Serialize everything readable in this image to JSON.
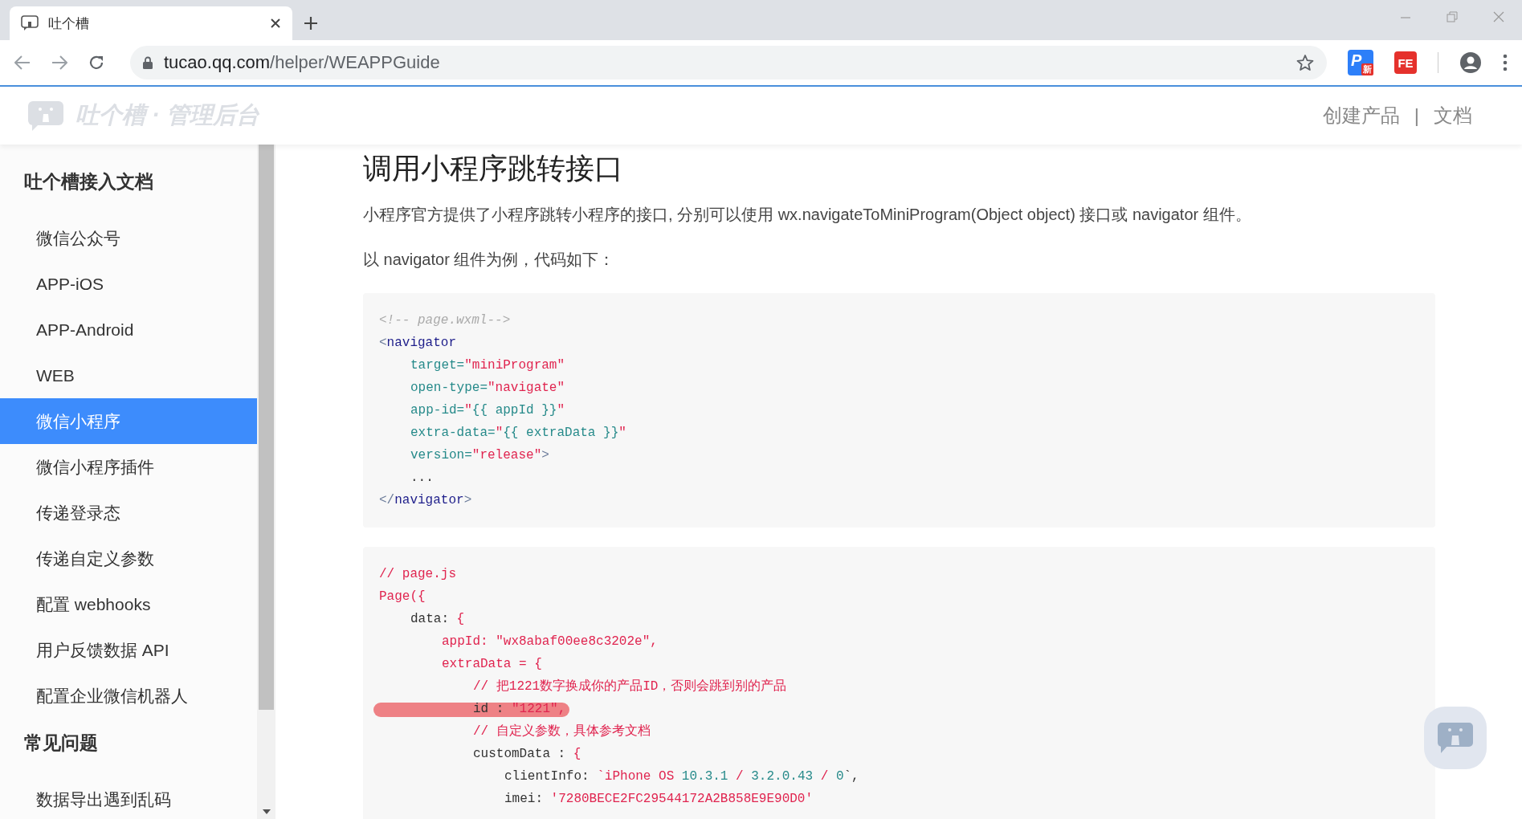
{
  "browser": {
    "tab": {
      "title": "吐个槽"
    },
    "url": {
      "host": "tucao.qq.com",
      "path": "/helper/WEAPPGuide"
    },
    "extensions": [
      {
        "label": "P",
        "badge": "新"
      },
      {
        "label": "FE"
      }
    ]
  },
  "header": {
    "logo": "吐个槽 · 管理后台",
    "links": [
      "创建产品",
      "文档"
    ],
    "separator": "|"
  },
  "sidebar": {
    "sections": [
      {
        "title": "吐个槽接入文档",
        "items": [
          {
            "label": "微信公众号",
            "selected": false
          },
          {
            "label": "APP-iOS",
            "selected": false
          },
          {
            "label": "APP-Android",
            "selected": false
          },
          {
            "label": "WEB",
            "selected": false
          },
          {
            "label": "微信小程序",
            "selected": true
          },
          {
            "label": "微信小程序插件",
            "selected": false
          },
          {
            "label": "传递登录态",
            "selected": false
          },
          {
            "label": "传递自定义参数",
            "selected": false
          },
          {
            "label": "配置 webhooks",
            "selected": false
          },
          {
            "label": "用户反馈数据 API",
            "selected": false
          },
          {
            "label": "配置企业微信机器人",
            "selected": false
          }
        ]
      },
      {
        "title": "常见问题",
        "items": [
          {
            "label": "数据导出遇到乱码",
            "selected": false
          }
        ]
      }
    ]
  },
  "article": {
    "title": "调用小程序跳转接口",
    "paragraphs": [
      "小程序官方提供了小程序跳转小程序的接口, 分别可以使用 wx.navigateToMiniProgram(Object object) 接口或 navigator 组件。",
      "以 navigator 组件为例，代码如下："
    ],
    "code_blocks": [
      {
        "lines": [
          {
            "tokens": [
              {
                "text": "<!-- page.wxml-->",
                "kind": "comment"
              }
            ]
          },
          {
            "tokens": [
              {
                "text": "<",
                "kind": "punct"
              },
              {
                "text": "navigator",
                "kind": "tag"
              }
            ],
            "children": [
              {
                "tokens": [
                  {
                    "text": "target=",
                    "kind": "attr"
                  },
                  {
                    "text": "\"miniProgram\"",
                    "kind": "string"
                  }
                ]
              },
              {
                "tokens": [
                  {
                    "text": "open-type=",
                    "kind": "attr"
                  },
                  {
                    "text": "\"navigate\"",
                    "kind": "string"
                  }
                ]
              },
              {
                "tokens": [
                  {
                    "text": "app-id=",
                    "kind": "attr"
                  },
                  {
                    "text": "\"",
                    "kind": "string"
                  },
                  {
                    "text": "{{ appId }}",
                    "kind": "attr"
                  },
                  {
                    "text": "\"",
                    "kind": "string"
                  }
                ]
              },
              {
                "tokens": [
                  {
                    "text": "extra-data=",
                    "kind": "attr"
                  },
                  {
                    "text": "\"",
                    "kind": "string"
                  },
                  {
                    "text": "{{ extraData }}",
                    "kind": "attr"
                  },
                  {
                    "text": "\"",
                    "kind": "string"
                  }
                ]
              },
              {
                "tokens": [
                  {
                    "text": "version=",
                    "kind": "attr"
                  },
                  {
                    "text": "\"release\"",
                    "kind": "string"
                  },
                  {
                    "text": ">",
                    "kind": "punct"
                  }
                ]
              },
              {
                "tokens": [
                  {
                    "text": "...",
                    "kind": "plain"
                  }
                ]
              }
            ]
          },
          {
            "tokens": [
              {
                "text": "</",
                "kind": "punct"
              },
              {
                "text": "navigator",
                "kind": "tag"
              },
              {
                "text": ">",
                "kind": "punct"
              }
            ]
          }
        ]
      },
      {
        "lines": [
          {
            "tokens": [
              {
                "text": "// page.js",
                "kind": "string"
              }
            ]
          },
          {
            "tokens": [
              {
                "text": "Page({",
                "kind": "string"
              }
            ],
            "children": [
              {
                "tokens": [
                  {
                    "text": "data: ",
                    "kind": "plain"
                  },
                  {
                    "text": "{",
                    "kind": "string"
                  }
                ],
                "children": [
                  {
                    "tokens": [
                      {
                        "text": "appId: \"wx8abaf00ee8c3202e\",",
                        "kind": "string"
                      }
                    ]
                  },
                  {
                    "tokens": [
                      {
                        "text": "extraData = {",
                        "kind": "string"
                      }
                    ],
                    "children": [
                      {
                        "tokens": [
                          {
                            "text": "// 把1221数字换成你的产品ID，否则会跳到别的产品",
                            "kind": "string"
                          }
                        ]
                      },
                      {
                        "tokens": [
                          {
                            "text": "id : ",
                            "kind": "plain"
                          },
                          {
                            "text": "\"1221\",",
                            "kind": "string"
                          }
                        ],
                        "marked": true
                      },
                      {
                        "tokens": [
                          {
                            "text": "// 自定义参数，具体参考文档",
                            "kind": "string"
                          }
                        ]
                      },
                      {
                        "tokens": [
                          {
                            "text": "customData : ",
                            "kind": "plain"
                          },
                          {
                            "text": "{",
                            "kind": "string"
                          }
                        ],
                        "children": [
                          {
                            "tokens": [
                              {
                                "text": "clientInfo: ",
                                "kind": "plain"
                              },
                              {
                                "text": "`iPhone OS ",
                                "kind": "string"
                              },
                              {
                                "text": "10.3.1",
                                "kind": "attr"
                              },
                              {
                                "text": " / ",
                                "kind": "string"
                              },
                              {
                                "text": "3.2.0.43",
                                "kind": "attr"
                              },
                              {
                                "text": " / ",
                                "kind": "string"
                              },
                              {
                                "text": "0",
                                "kind": "attr"
                              },
                              {
                                "text": "`,",
                                "kind": "plain"
                              }
                            ]
                          },
                          {
                            "tokens": [
                              {
                                "text": "imei: ",
                                "kind": "plain"
                              },
                              {
                                "text": "'7280BECE2FC29544172A2B858E9E90D0'",
                                "kind": "string"
                              }
                            ]
                          }
                        ]
                      }
                    ]
                  }
                ]
              }
            ]
          }
        ]
      }
    ]
  }
}
